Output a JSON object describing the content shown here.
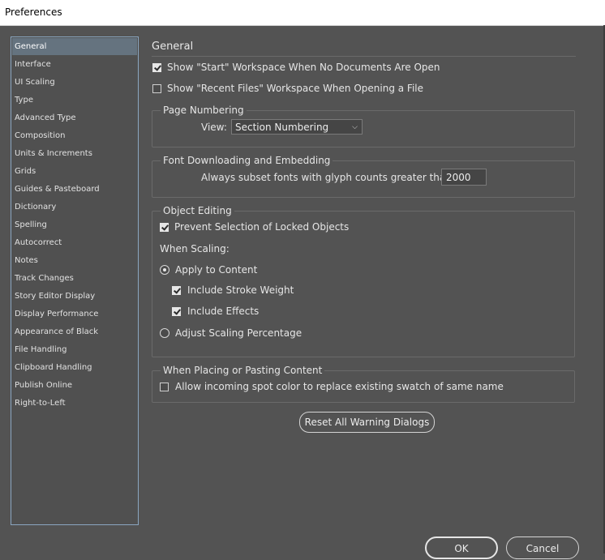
{
  "window": {
    "title": "Preferences"
  },
  "sidebar": {
    "items": [
      {
        "label": "General",
        "selected": true
      },
      {
        "label": "Interface"
      },
      {
        "label": "UI Scaling"
      },
      {
        "label": "Type"
      },
      {
        "label": "Advanced Type"
      },
      {
        "label": "Composition"
      },
      {
        "label": "Units & Increments"
      },
      {
        "label": "Grids"
      },
      {
        "label": "Guides & Pasteboard"
      },
      {
        "label": "Dictionary"
      },
      {
        "label": "Spelling"
      },
      {
        "label": "Autocorrect"
      },
      {
        "label": "Notes"
      },
      {
        "label": "Track Changes"
      },
      {
        "label": "Story Editor Display"
      },
      {
        "label": "Display Performance"
      },
      {
        "label": "Appearance of Black"
      },
      {
        "label": "File Handling"
      },
      {
        "label": "Clipboard Handling"
      },
      {
        "label": "Publish Online"
      },
      {
        "label": "Right-to-Left"
      }
    ]
  },
  "main": {
    "title": "General",
    "show_start_workspace": {
      "label": "Show \"Start\" Workspace When No Documents Are Open",
      "checked": true
    },
    "show_recent_files": {
      "label": "Show \"Recent Files\" Workspace When Opening a File",
      "checked": false
    },
    "page_numbering": {
      "title": "Page Numbering",
      "view_label": "View:",
      "view_value": "Section Numbering"
    },
    "font_downloading": {
      "title": "Font Downloading and Embedding",
      "subset_label": "Always subset fonts with glyph counts greater than:",
      "subset_value": "2000"
    },
    "object_editing": {
      "title": "Object Editing",
      "prevent_selection": {
        "label": "Prevent Selection of Locked Objects",
        "checked": true
      },
      "when_scaling_label": "When Scaling:",
      "apply_to_content": {
        "label": "Apply to Content",
        "selected": true
      },
      "include_stroke": {
        "label": "Include Stroke Weight",
        "checked": true
      },
      "include_effects": {
        "label": "Include Effects",
        "checked": true
      },
      "adjust_scaling": {
        "label": "Adjust Scaling Percentage",
        "selected": false
      }
    },
    "placing": {
      "title": "When Placing or Pasting Content",
      "spot_color": {
        "label": "Allow incoming spot color to replace existing swatch of same name",
        "checked": false
      }
    },
    "reset_button": "Reset All Warning Dialogs"
  },
  "footer": {
    "ok": "OK",
    "cancel": "Cancel"
  }
}
